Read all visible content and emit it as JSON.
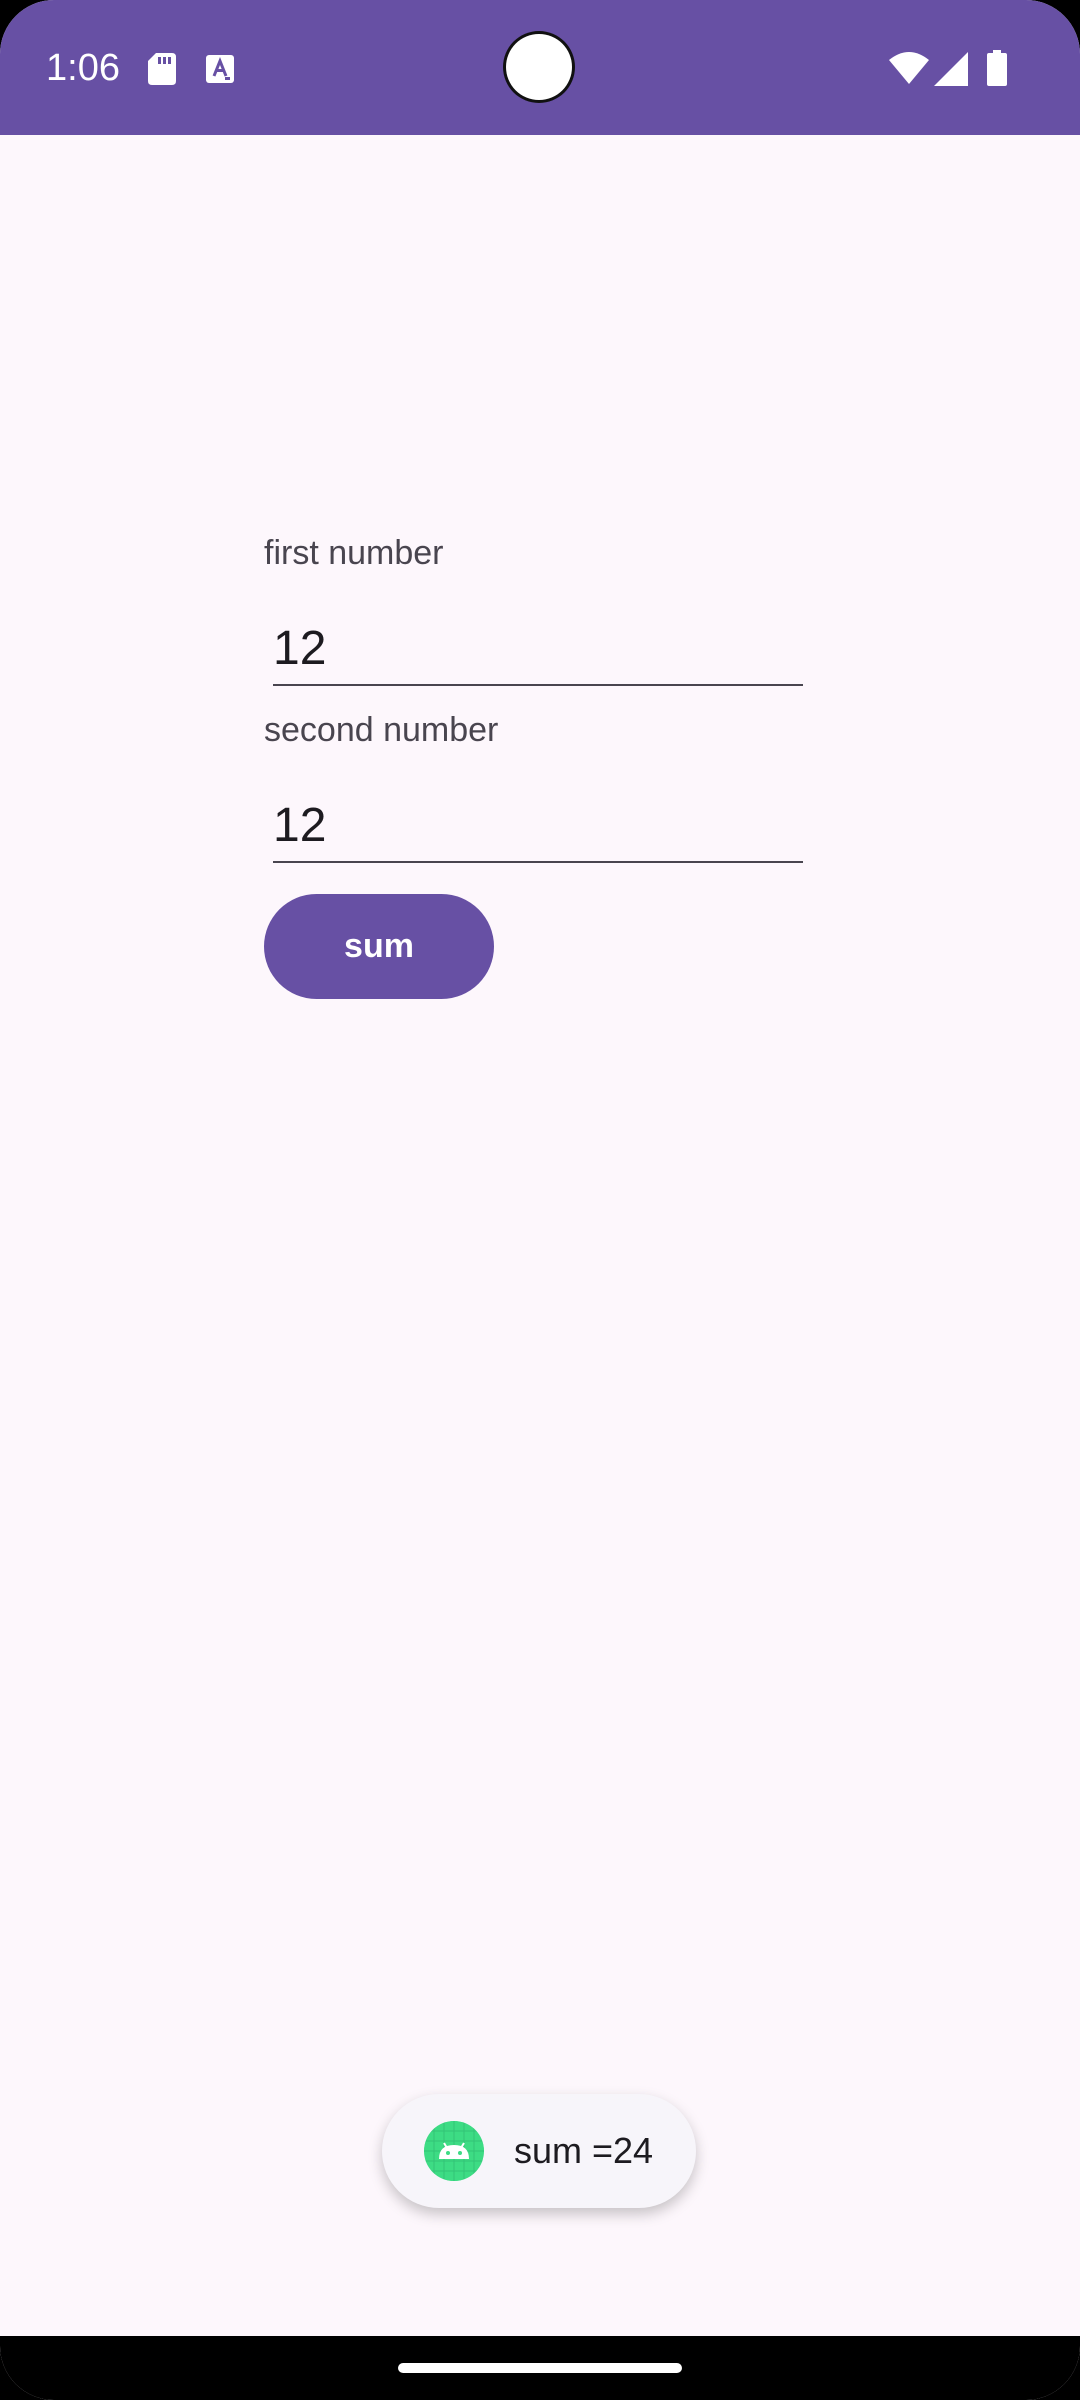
{
  "status_bar": {
    "time": "1:06",
    "icons": [
      "sd-card-icon",
      "text-a-icon",
      "wifi-icon",
      "cell-signal-icon",
      "battery-icon"
    ],
    "color": "#6750A4"
  },
  "form": {
    "first_label": "first number",
    "first_value": "12",
    "second_label": "second number",
    "second_value": "12",
    "button_label": "sum",
    "accent_color": "#6750A4"
  },
  "toast": {
    "message": "sum =24",
    "icon": "android-icon"
  }
}
